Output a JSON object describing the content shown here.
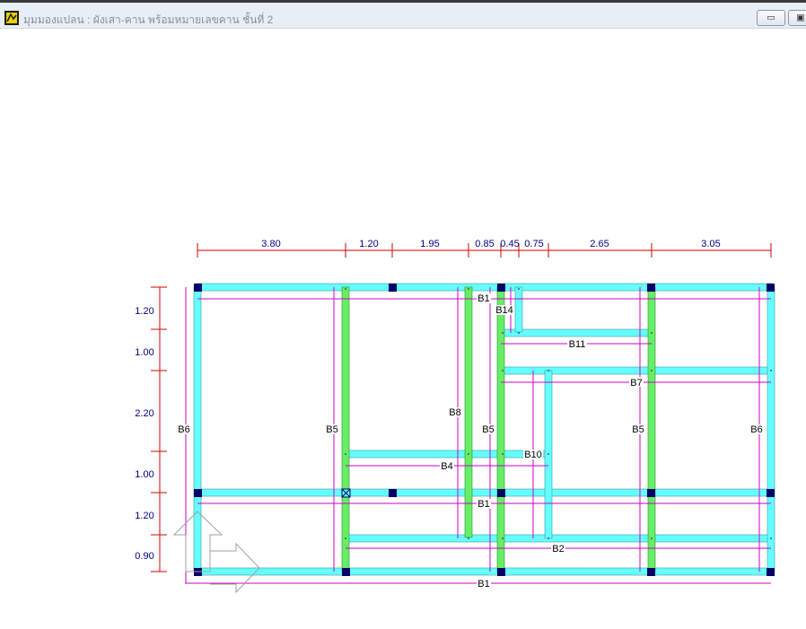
{
  "window": {
    "title": "มุมมองแปลน : ผังเสา-คาน พร้อมหมายเลขคาน ชั้นที่ 2",
    "minimize_glyph": "▭",
    "maximize_glyph": "▣"
  },
  "dimensions": {
    "top": [
      "3.80",
      "1.20",
      "1.95",
      "0.85",
      "0.45",
      "0.75",
      "2.65",
      "3.05"
    ],
    "left": [
      "1.20",
      "1.00",
      "2.20",
      "1.00",
      "1.20",
      "0.90"
    ]
  },
  "beam_labels": {
    "b1_top": "B1",
    "b14": "B14",
    "b11": "B11",
    "b7": "B7",
    "b6_left": "B6",
    "b5_a": "B5",
    "b8": "B8",
    "b5_b": "B5",
    "b10": "B10",
    "b5_c": "B5",
    "b6_right": "B6",
    "b4": "B4",
    "b1_mid": "B1",
    "b2": "B2",
    "b1_bottom": "B1"
  },
  "colors": {
    "beam": "#66ffff",
    "secondary_beam": "#66ee66",
    "column": "#000066",
    "dimension": "#cc0000",
    "beam_line": "#cc00cc"
  }
}
